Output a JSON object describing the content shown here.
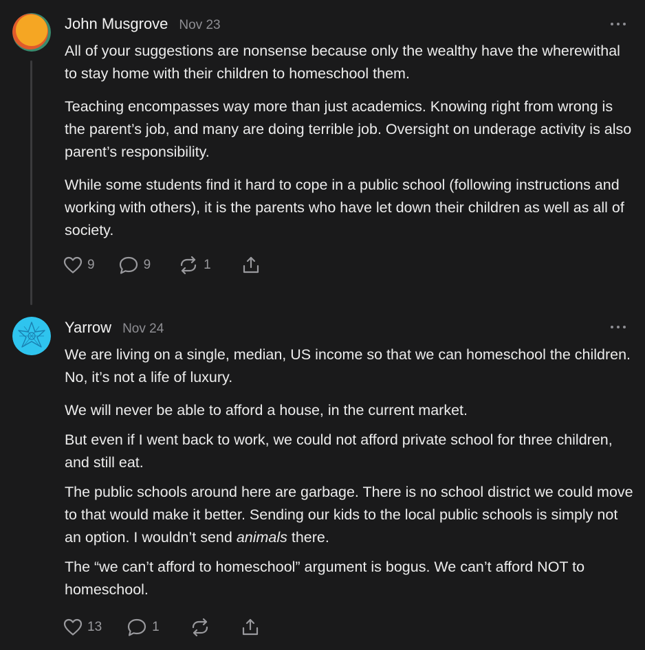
{
  "comments": [
    {
      "author": "John Musgrove",
      "date": "Nov 23",
      "paragraphs": [
        "All of your suggestions are nonsense because only the wealthy have the wherewithal to stay home with their children to homeschool them.",
        "Teaching encompasses way more than just academics. Knowing right from wrong is the parent’s job, and many are doing terrible job. Oversight on underage activity is also parent’s responsibility.",
        "While some students find it hard to cope in a public school (following instructions and working with others), it is the parents who have let down their children as well as all of society."
      ],
      "likes": "9",
      "replies": "9",
      "restacks": "1",
      "avatar_colors": [
        "#f5a623",
        "#e05a2b",
        "#3a8c6e"
      ]
    },
    {
      "author": "Yarrow",
      "date": "Nov 24",
      "paragraphs": [
        "We are living on a single, median, US income so that we can homeschool the children. No, it’s not a life of luxury.",
        "We will never be able to afford a house, in the current market.",
        "But even if I went back to work, we could not afford private school for three children, and still eat.",
        "The public schools around here are garbage. There is no school district we could move to that would make it better. Sending our kids to the local public schools is simply not an option. I wouldn’t send ",
        "animals",
        " there.",
        "The “we can’t afford to homeschool” argument is bogus. We can’t afford NOT to homeschool."
      ],
      "likes": "13",
      "replies": "1",
      "restacks": "",
      "avatar_colors": [
        "#2fc4ee",
        "#1a7fb0"
      ]
    }
  ],
  "icons": {
    "like": "heart-icon",
    "reply": "comment-bubble-icon",
    "restack": "restack-arrows-icon",
    "share": "share-icon",
    "more": "more-dots-icon"
  },
  "colors": {
    "background": "#1a1a1b",
    "text": "#ececec",
    "muted": "#8e8e93"
  }
}
